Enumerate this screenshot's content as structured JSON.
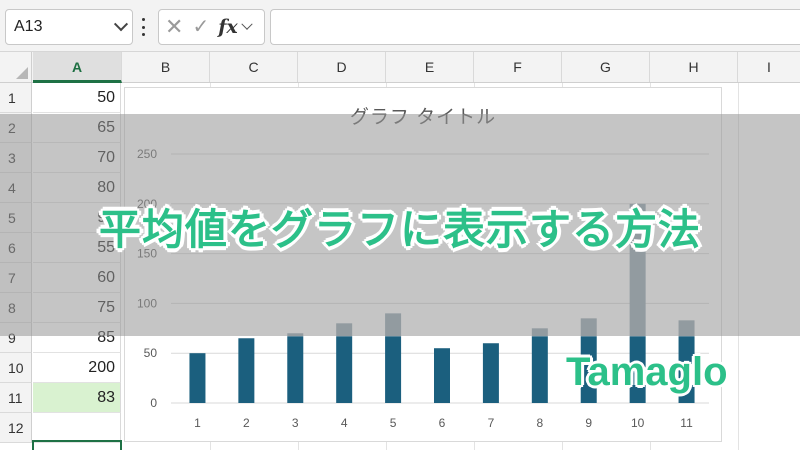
{
  "formula_bar": {
    "name_box_value": "A13",
    "cancel_icon": "close-icon",
    "enter_icon": "check-icon",
    "function_label": "fx",
    "formula_value": ""
  },
  "columns": [
    "A",
    "B",
    "C",
    "D",
    "E",
    "F",
    "G",
    "H",
    "I"
  ],
  "selected_column": "A",
  "rows": [
    {
      "num": "1",
      "a": "50"
    },
    {
      "num": "2",
      "a": "65"
    },
    {
      "num": "3",
      "a": "70"
    },
    {
      "num": "4",
      "a": "80"
    },
    {
      "num": "5",
      "a": "90"
    },
    {
      "num": "6",
      "a": "55"
    },
    {
      "num": "7",
      "a": "60"
    },
    {
      "num": "8",
      "a": "75"
    },
    {
      "num": "9",
      "a": "85"
    },
    {
      "num": "10",
      "a": "200"
    },
    {
      "num": "11",
      "a": "83"
    },
    {
      "num": "12",
      "a": ""
    }
  ],
  "chart_data": {
    "type": "bar",
    "title": "グラフ タイトル",
    "categories": [
      "1",
      "2",
      "3",
      "4",
      "5",
      "6",
      "7",
      "8",
      "9",
      "10",
      "11"
    ],
    "series": [
      {
        "values": [
          50,
          65,
          67,
          67,
          67,
          55,
          60,
          67,
          67,
          67,
          67
        ]
      },
      {
        "values": [
          0,
          0,
          3,
          13,
          23,
          0,
          0,
          8,
          18,
          133,
          16
        ]
      }
    ],
    "ylim": [
      0,
      250
    ],
    "yticks": [
      "0",
      "50",
      "100",
      "150",
      "200",
      "250"
    ],
    "stacked": true,
    "grid": true,
    "colors": [
      "#1b5f7e",
      "#8fa3ae"
    ]
  },
  "banner": {
    "title": "平均値をグラフに表示する方法",
    "logo": "Tamaglo",
    "accent_color": "#2cc089"
  }
}
